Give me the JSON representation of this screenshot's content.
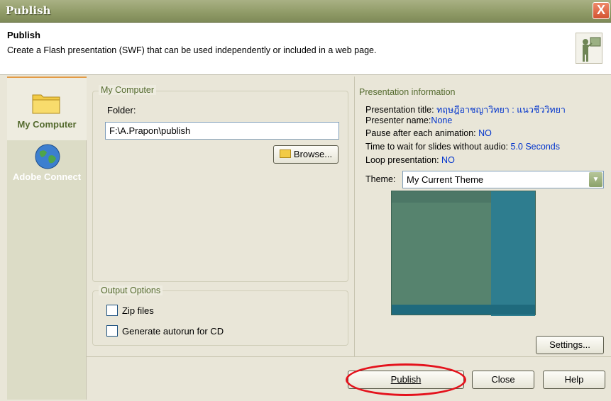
{
  "window": {
    "title": "Publish",
    "close_glyph": "X"
  },
  "header": {
    "title": "Publish",
    "description": "Create a Flash presentation (SWF) that can be used independently or included in a web page."
  },
  "nav": {
    "items": [
      {
        "label": "My Computer",
        "icon": "folder-icon"
      },
      {
        "label": "Adobe Connect",
        "icon": "globe-icon"
      }
    ]
  },
  "my_computer": {
    "legend": "My Computer",
    "folder_label": "Folder:",
    "folder_value": "F:\\A.Prapon\\publish",
    "browse_label": "Browse..."
  },
  "output_options": {
    "legend": "Output Options",
    "zip_label": "Zip files",
    "autorun_label": "Generate autorun for CD"
  },
  "presentation_info": {
    "heading": "Presentation information",
    "title_label": "Presentation title:",
    "title_value": "ทฤษฎีอาชญาวิทยา : แนวชีววิทยา",
    "presenter_label": "Presenter name:",
    "presenter_value": "None",
    "pause_label": "Pause after each animation:",
    "pause_value": "NO",
    "wait_label": "Time to wait for slides without audio:",
    "wait_value": "5.0 Seconds",
    "loop_label": "Loop presentation:",
    "loop_value": "NO",
    "theme_label": "Theme:",
    "theme_value": "My Current Theme"
  },
  "buttons": {
    "settings": "Settings...",
    "publish": "Publish",
    "close": "Close",
    "help": "Help"
  },
  "colors": {
    "accent_green": "#556b2f",
    "value_blue": "#0033cc",
    "highlight_red": "#e4121c"
  }
}
